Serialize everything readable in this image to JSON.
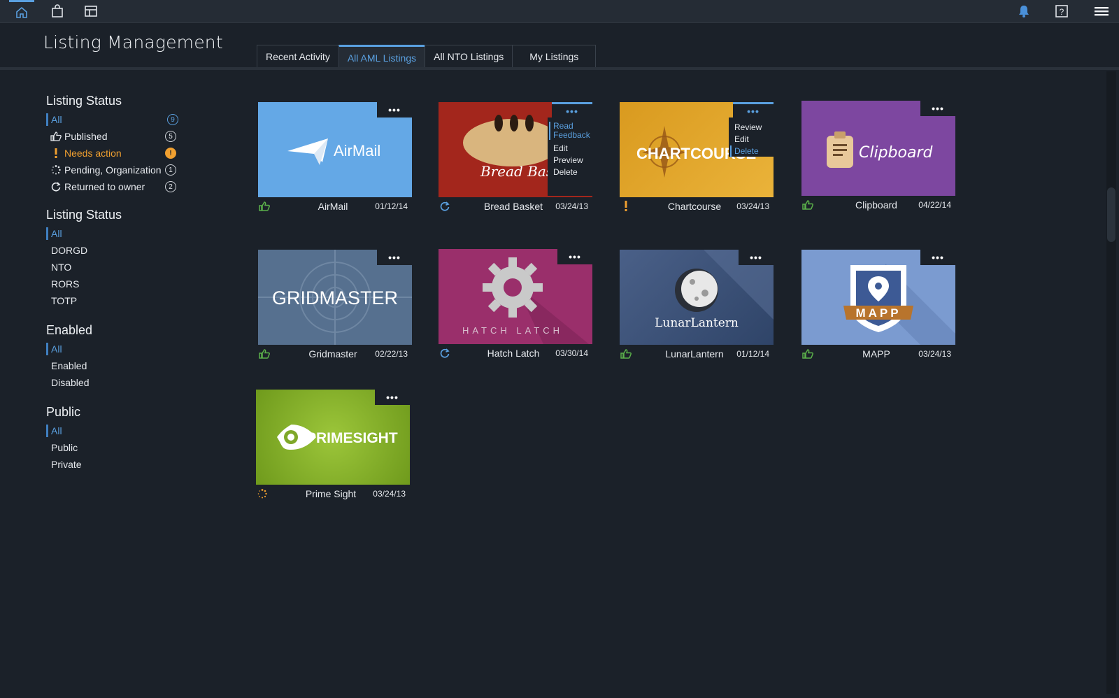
{
  "nav": {
    "icons": [
      "home-icon",
      "bag-icon",
      "layout-icon",
      "bell-icon",
      "help-icon",
      "menu-icon"
    ]
  },
  "page": {
    "title": "Listing Management"
  },
  "tabs": [
    {
      "label": "Recent Activity"
    },
    {
      "label": "All AML Listings",
      "active": true
    },
    {
      "label": "All NTO Listings"
    },
    {
      "label": "My Listings"
    }
  ],
  "filters": {
    "status": {
      "title": "Listing Status",
      "items": [
        {
          "label": "All",
          "count": "9"
        },
        {
          "label": "Published",
          "count": "5"
        },
        {
          "label": "Needs action",
          "count": "!"
        },
        {
          "label": "Pending, Organization",
          "count": "1"
        },
        {
          "label": "Returned to owner",
          "count": "2"
        }
      ]
    },
    "org": {
      "title": "Listing Status",
      "items": [
        "All",
        "DORGD",
        "NTO",
        "RORS",
        "TOTP"
      ]
    },
    "enabled": {
      "title": "Enabled",
      "items": [
        "All",
        "Enabled",
        "Disabled"
      ]
    },
    "public": {
      "title": "Public",
      "items": [
        "All",
        "Public",
        "Private"
      ]
    }
  },
  "colors": {
    "accent": "#5aa0e0",
    "warning": "#f0a030",
    "published": "#5bb04a",
    "background": "#1b2129"
  },
  "listings": [
    {
      "name": "AirMail",
      "date": "01/12/14",
      "status": "published",
      "logo": "AirMail",
      "bg": "#64a8e6"
    },
    {
      "name": "Bread Basket",
      "date": "03/24/13",
      "status": "returned",
      "logo": "Bread Basket",
      "bg": "#a3261c",
      "menu": [
        "Read Feedback",
        "Edit",
        "Preview",
        "Delete"
      ]
    },
    {
      "name": "Chartcourse",
      "date": "03/24/13",
      "status": "needs-action",
      "logo": "CHARTCOURSE",
      "bg": "#e0a82a",
      "menu": [
        "Review",
        "Edit",
        "Delete"
      ]
    },
    {
      "name": "Clipboard",
      "date": "04/22/14",
      "status": "published",
      "logo": "Clipboard",
      "bg": "#7d47a0"
    },
    {
      "name": "Gridmaster",
      "date": "02/22/13",
      "status": "published",
      "logo": "GRIDMASTER",
      "bg": "#56708f"
    },
    {
      "name": "Hatch Latch",
      "date": "03/30/14",
      "status": "returned",
      "logo": "HATCH LATCH",
      "bg": "#9a2f6b"
    },
    {
      "name": "LunarLantern",
      "date": "01/12/14",
      "status": "published",
      "logo": "LunarLantern",
      "bg": "#3c5378"
    },
    {
      "name": "MAPP",
      "date": "03/24/13",
      "status": "published",
      "logo": "MAPP",
      "bg": "#7b9bd0"
    },
    {
      "name": "Prime Sight",
      "date": "03/24/13",
      "status": "pending",
      "logo": "PRIMESIGHT",
      "bg": "#86b52a"
    }
  ]
}
